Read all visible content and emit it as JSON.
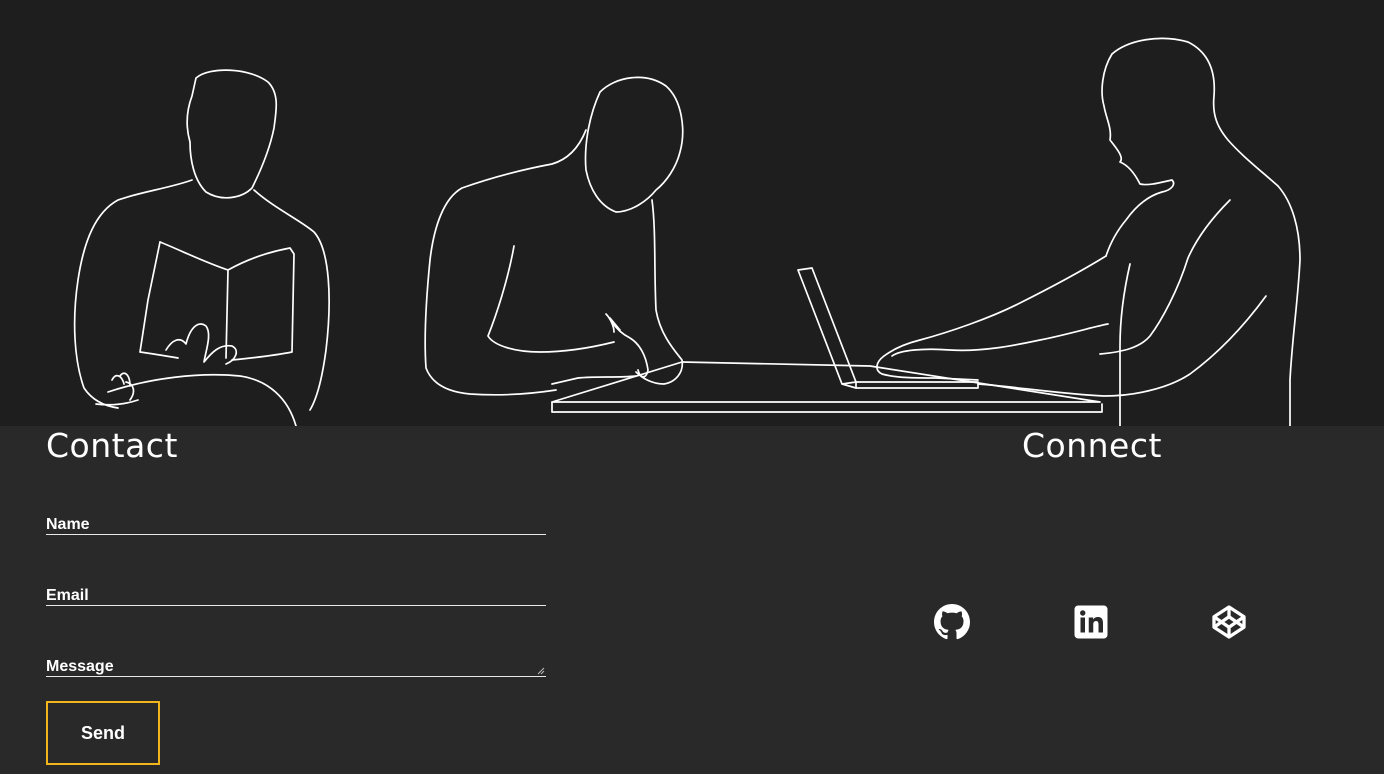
{
  "hero": {
    "illustration_icon": "people-line-art-illustration",
    "background": "#1e1e1e"
  },
  "contact": {
    "title": "Contact",
    "fields": {
      "name_label": "Name",
      "email_label": "Email",
      "message_label": "Message"
    },
    "send_label": "Send",
    "accent_color": "#f2b51c"
  },
  "connect": {
    "title": "Connect",
    "links": [
      {
        "icon": "github-icon"
      },
      {
        "icon": "linkedin-icon"
      },
      {
        "icon": "codepen-icon"
      }
    ]
  },
  "colors": {
    "page_background": "#292929",
    "text": "#ffffff"
  }
}
